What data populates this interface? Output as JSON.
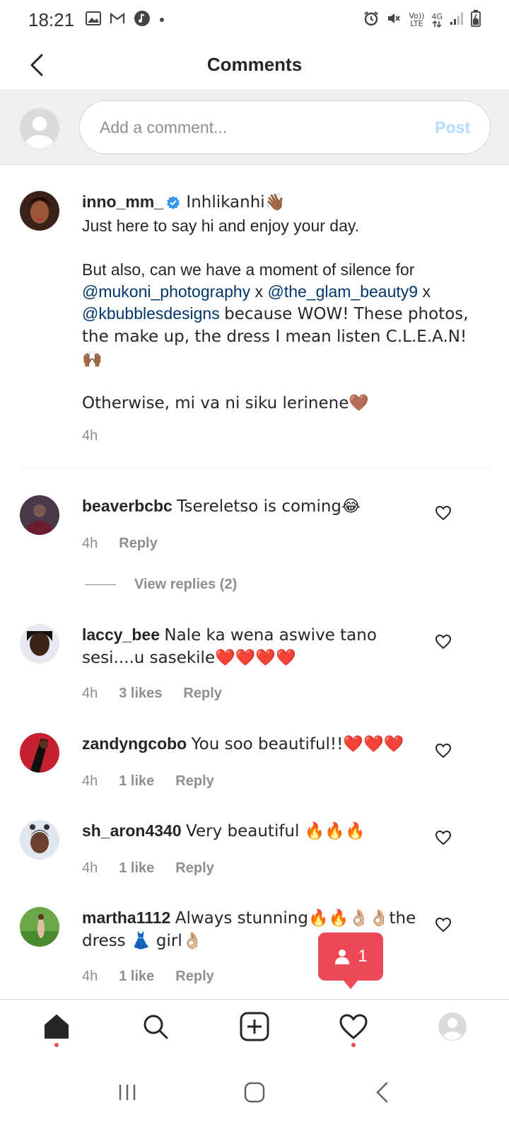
{
  "status_bar": {
    "time": "18:21",
    "volte_label": "Vo)) LTE",
    "network_label": "4G",
    "icons": [
      "gallery-icon",
      "gmail-icon",
      "music-icon",
      "dot-icon",
      "alarm-icon",
      "mute-icon",
      "volte-icon",
      "network-4g-icon",
      "signal-icon",
      "battery-icon"
    ]
  },
  "header": {
    "title": "Comments"
  },
  "composer": {
    "placeholder": "Add a comment...",
    "post_label": "Post"
  },
  "caption": {
    "username": "inno_mm_",
    "line1": "Inhlikanhi👋🏾",
    "line2": "Just here to say hi and enjoy your day.",
    "line3_prefix": "But also, can we have a moment of silence for",
    "mention1": "@mukoni_photography",
    "sep1": "x",
    "mention2": "@the_glam_beauty9",
    "sep2": "x",
    "mention3": "@kbubblesdesigns",
    "line3_suffix": "because WOW! These photos, the make up, the dress I mean listen C.L.E.A.N!🙌🏾",
    "line4": "Otherwise, mi va ni siku lerinene🤎",
    "time": "4h"
  },
  "comments": [
    {
      "username": "beaverbcbc",
      "text": "Tsereletso is coming😂",
      "time": "4h",
      "likes": "",
      "reply": "Reply"
    },
    {
      "username": "laccy_bee",
      "text": "Nale ka wena aswive tano sesi....u sasekile❤️❤️❤️❤️",
      "time": "4h",
      "likes": "3 likes",
      "reply": "Reply"
    },
    {
      "username": "zandyngcobo",
      "text": "You soo beautiful!!❤️❤️❤️",
      "time": "4h",
      "likes": "1 like",
      "reply": "Reply"
    },
    {
      "username": "sh_aron4340",
      "text": "Very beautiful 🔥🔥🔥",
      "time": "4h",
      "likes": "1 like",
      "reply": "Reply"
    },
    {
      "username": "martha1112",
      "text": "Always stunning🔥🔥👌🏼👌🏼the dress 👗 girl👌🏼",
      "time": "4h",
      "likes": "1 like",
      "reply": "Reply"
    }
  ],
  "view_replies": "View replies (2)",
  "notification": {
    "count": "1"
  },
  "colors": {
    "accent": "#ed4956",
    "link": "#00376b",
    "post_disabled": "#b3dbff",
    "muted": "#8e8e8e",
    "verified": "#3897f0"
  }
}
